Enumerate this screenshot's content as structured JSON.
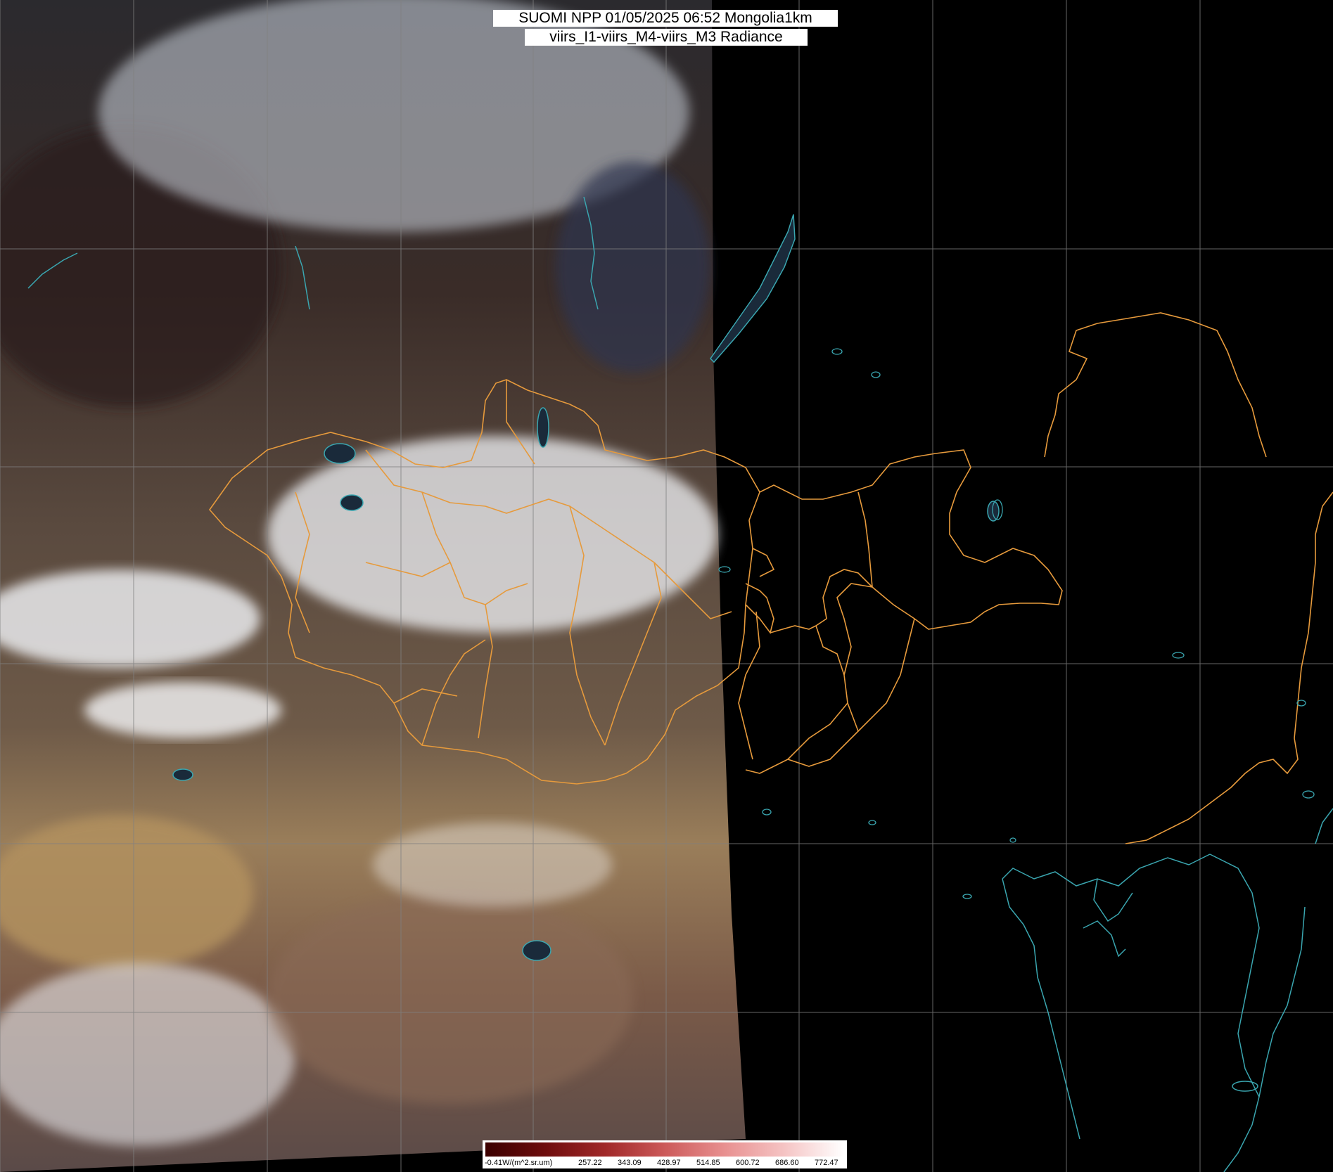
{
  "header": {
    "line1": "SUOMI NPP 01/05/2025 06:52 Mongolia1km",
    "line2": "viirs_I1-viirs_M4-viirs_M3 Radiance"
  },
  "colors": {
    "border": "#e69a3c",
    "coastline": "#3aa6b0",
    "graticule": "#808080",
    "night": "#000000",
    "cloud": "#f2f4f8",
    "desert": "#a88a62",
    "forest": "#3a2c26"
  },
  "colorbar": {
    "unit_label": "-0.41W/(m^2.sr.um)",
    "ticks": [
      "257.22",
      "343.09",
      "428.97",
      "514.85",
      "600.72",
      "686.60",
      "772.47"
    ],
    "gradient": [
      "#3b0000",
      "#6e0d0d",
      "#a02828",
      "#cc5a5a",
      "#e89090",
      "#f5c4c4",
      "#ffffff"
    ]
  }
}
